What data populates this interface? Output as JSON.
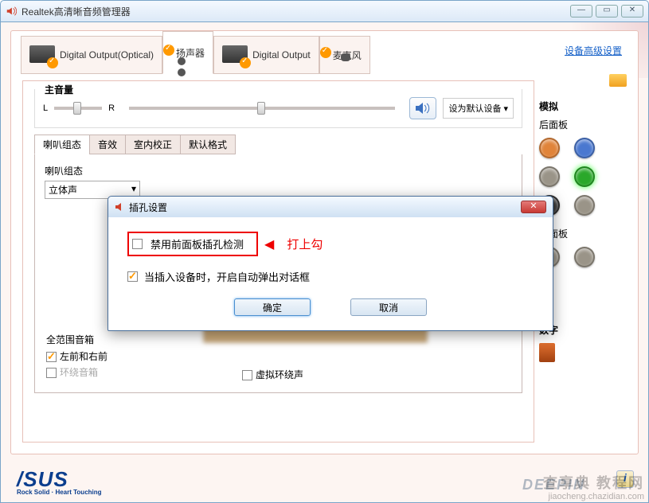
{
  "window": {
    "title": "Realtek高清晰音频管理器"
  },
  "tabs": {
    "digital_optical": "Digital Output(Optical)",
    "speakers": "扬声器",
    "digital_output": "Digital Output",
    "microphone": "麦克风"
  },
  "advanced_link": "设备高级设置",
  "volume": {
    "legend": "主音量",
    "left": "L",
    "right": "R",
    "set_default": "设为默认设备"
  },
  "subtabs": {
    "speaker_config": "喇叭组态",
    "sound_effect": "音效",
    "room_correction": "室内校正",
    "default_format": "默认格式"
  },
  "speaker_config": {
    "label": "喇叭组态",
    "stereo": "立体声"
  },
  "full_range": {
    "legend": "全范围音箱",
    "front": "左前和右前",
    "surround": "环绕音箱"
  },
  "virtual_surround": "虚拟环绕声",
  "jacks": {
    "analog": "模拟",
    "back_panel": "后面板",
    "front_panel": "前面板",
    "digital": "数字",
    "colors": {
      "orange": "#e0843a",
      "blue": "#4a78d0",
      "gray1": "#9a9488",
      "green": "#2aa82a",
      "black": "#3a3a3a",
      "gray2": "#9a9488",
      "fp1": "#9a9488",
      "fp2": "#9a9488"
    }
  },
  "modal": {
    "title": "插孔设置",
    "opt1": "禁用前面板插孔检测",
    "opt2": "当插入设备时，开启自动弹出对话框",
    "ok": "确定",
    "cancel": "取消"
  },
  "annotation": "打上勾",
  "logo": {
    "brand": "/SUS",
    "tagline": "Rock Solid · Heart Touching"
  },
  "watermark": {
    "deepin": "DEEPIN",
    "site1": "查享典 教程网",
    "site2": "jiaocheng.chazidian.com"
  }
}
